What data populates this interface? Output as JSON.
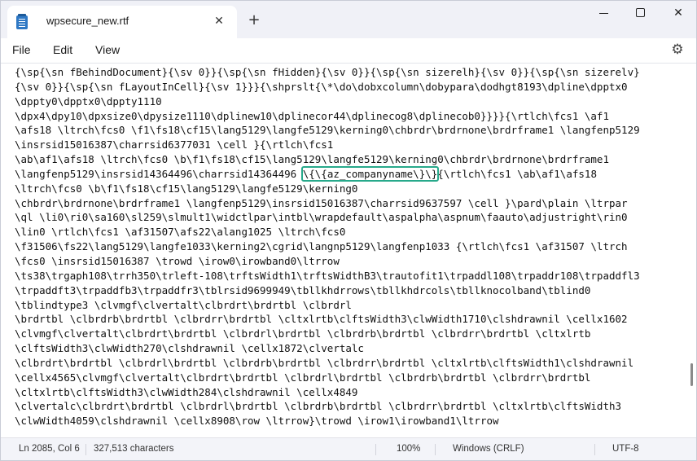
{
  "window": {
    "tab_title": "wpsecure_new.rtf",
    "icons": {
      "app": "notepad-icon",
      "tab_close": "close-icon",
      "new_tab": "plus-icon",
      "minimize": "minimize-icon",
      "maximize": "maximize-icon",
      "close": "close-icon",
      "settings": "gear-icon"
    }
  },
  "menu": {
    "file": "File",
    "edit": "Edit",
    "view": "View"
  },
  "editor": {
    "lines": [
      "{\\sp{\\sn fBehindDocument}{\\sv 0}}{\\sp{\\sn fHidden}{\\sv 0}}{\\sp{\\sn sizerelh}{\\sv 0}}{\\sp{\\sn sizerelv}",
      "{\\sv 0}}{\\sp{\\sn fLayoutInCell}{\\sv 1}}}{\\shprslt{\\*\\do\\dobxcolumn\\dobypara\\dodhgt8193\\dpline\\dpptx0",
      "\\dppty0\\dpptx0\\dppty1110",
      "\\dpx4\\dpy10\\dpxsize0\\dpysize1110\\dplinew10\\dplinecor44\\dplinecog8\\dplinecob0}}}}{\\rtlch\\fcs1 \\af1",
      "\\afs18 \\ltrch\\fcs0 \\f1\\fs18\\cf15\\lang5129\\langfe5129\\kerning0\\chbrdr\\brdrnone\\brdrframe1 \\langfenp5129",
      "\\insrsid15016387\\charrsid6377031 \\cell }{\\rtlch\\fcs1",
      "\\ab\\af1\\afs18 \\ltrch\\fcs0 \\b\\f1\\fs18\\cf15\\lang5129\\langfe5129\\kerning0\\chbrdr\\brdrnone\\brdrframe1",
      "__HL__",
      "\\ltrch\\fcs0 \\b\\f1\\fs18\\cf15\\lang5129\\langfe5129\\kerning0",
      "\\chbrdr\\brdrnone\\brdrframe1 \\langfenp5129\\insrsid15016387\\charrsid9637597 \\cell }\\pard\\plain \\ltrpar",
      "\\ql \\li0\\ri0\\sa160\\sl259\\slmult1\\widctlpar\\intbl\\wrapdefault\\aspalpha\\aspnum\\faauto\\adjustright\\rin0",
      "\\lin0 \\rtlch\\fcs1 \\af31507\\afs22\\alang1025 \\ltrch\\fcs0",
      "\\f31506\\fs22\\lang5129\\langfe1033\\kerning2\\cgrid\\langnp5129\\langfenp1033 {\\rtlch\\fcs1 \\af31507 \\ltrch",
      "\\fcs0 \\insrsid15016387 \\trowd \\irow0\\irowband0\\ltrrow",
      "\\ts38\\trgaph108\\trrh350\\trleft-108\\trftsWidth1\\trftsWidthB3\\trautofit1\\trpaddl108\\trpaddr108\\trpaddfl3",
      "\\trpaddft3\\trpaddfb3\\trpaddfr3\\tblrsid9699949\\tbllkhdrrows\\tbllkhdrcols\\tbllknocolband\\tblind0",
      "\\tblindtype3 \\clvmgf\\clvertalt\\clbrdrt\\brdrtbl \\clbrdrl",
      "\\brdrtbl \\clbrdrb\\brdrtbl \\clbrdrr\\brdrtbl \\cltxlrtb\\clftsWidth3\\clwWidth1710\\clshdrawnil \\cellx1602",
      "\\clvmgf\\clvertalt\\clbrdrt\\brdrtbl \\clbrdrl\\brdrtbl \\clbrdrb\\brdrtbl \\clbrdrr\\brdrtbl \\cltxlrtb",
      "\\clftsWidth3\\clwWidth270\\clshdrawnil \\cellx1872\\clvertalc",
      "\\clbrdrt\\brdrtbl \\clbrdrl\\brdrtbl \\clbrdrb\\brdrtbl \\clbrdrr\\brdrtbl \\cltxlrtb\\clftsWidth1\\clshdrawnil",
      "\\cellx4565\\clvmgf\\clvertalt\\clbrdrt\\brdrtbl \\clbrdrl\\brdrtbl \\clbrdrb\\brdrtbl \\clbrdrr\\brdrtbl",
      "\\cltxlrtb\\clftsWidth3\\clwWidth284\\clshdrawnil \\cellx4849",
      "\\clvertalc\\clbrdrt\\brdrtbl \\clbrdrl\\brdrtbl \\clbrdrb\\brdrtbl \\clbrdrr\\brdrtbl \\cltxlrtb\\clftsWidth3",
      "\\clwWidth4059\\clshdrawnil \\cellx8908\\row \\ltrrow}\\trowd \\irow1\\irowband1\\ltrrow"
    ],
    "highlight_line": {
      "before": "\\langfenp5129\\insrsid14364496\\charrsid14364496 ",
      "highlight": "\\{\\{az_companyname\\}\\}",
      "after": "{\\rtlch\\fcs1 \\ab\\af1\\afs18"
    }
  },
  "status": {
    "position": "Ln 2085, Col 6",
    "characters": "327,513 characters",
    "zoom": "100%",
    "line_ending": "Windows (CRLF)",
    "encoding": "UTF-8"
  },
  "colors": {
    "highlight_border": "#27a98b",
    "app_icon": "#2f78c4"
  }
}
